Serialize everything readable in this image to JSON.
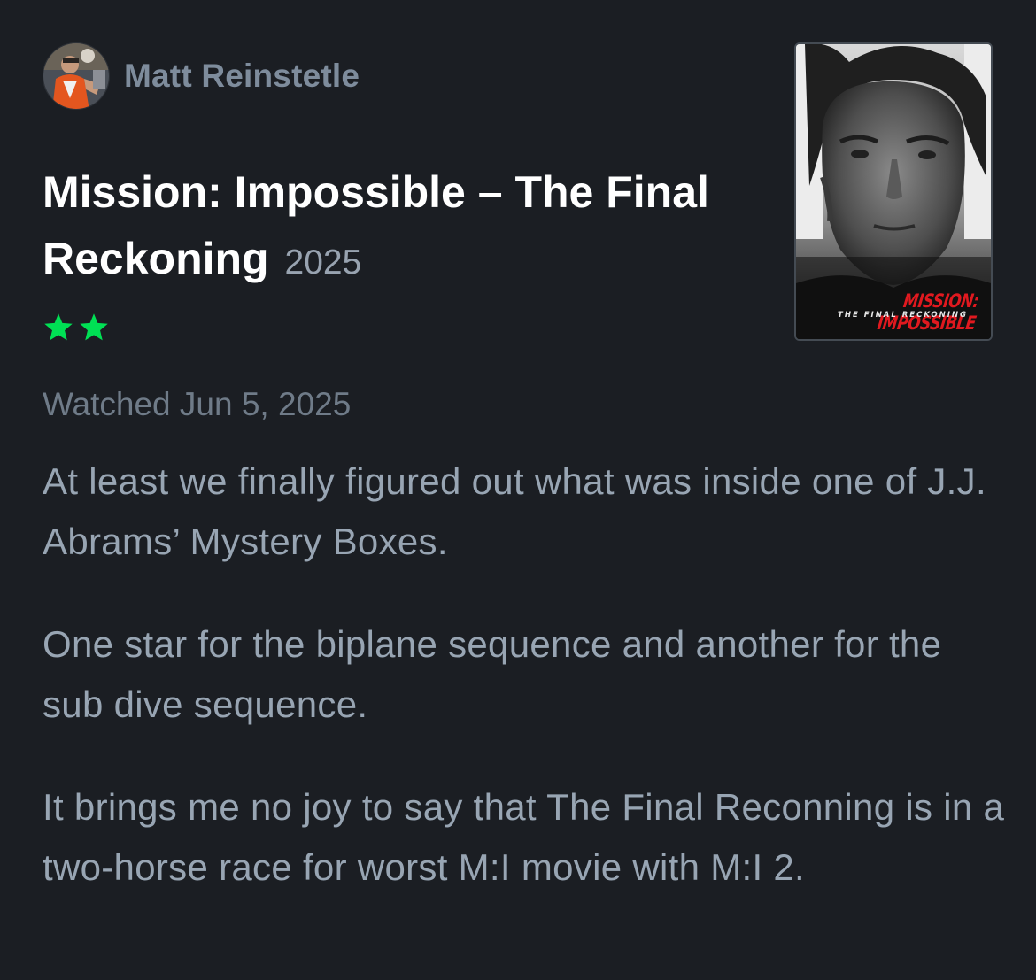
{
  "review": {
    "author": {
      "name": "Matt Reinstetle"
    },
    "film": {
      "title": "Mission: Impossible – The Final Reckoning",
      "year": "2025"
    },
    "rating": {
      "stars": 2,
      "max": 5,
      "color": "#00e054"
    },
    "watched": "Watched Jun 5, 2025",
    "paragraphs": [
      "At least we finally figured out what was inside one of J.J. Abrams’ Mystery Boxes.",
      "One star for the biplane sequence and another for the sub dive sequence.",
      "It brings me no joy to say that The Final Reconning is in a two-horse race for worst M:I movie with M:I 2."
    ],
    "poster": {
      "title": "MISSION: IMPOSSIBLE",
      "subtitle": "THE FINAL RECKONING"
    }
  },
  "colors": {
    "background": "#1b1e23",
    "author": "#7e8c9c",
    "title": "#ffffff",
    "body": "#98a5b3",
    "muted": "#6f7b88"
  }
}
